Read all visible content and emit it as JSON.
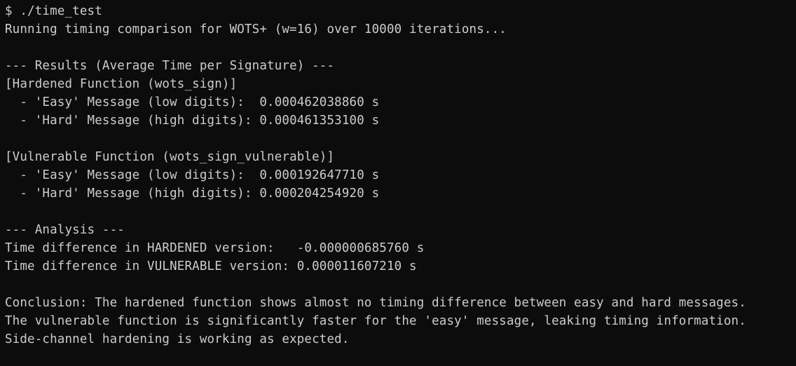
{
  "terminal": {
    "lines": [
      "$ ./time_test",
      "Running timing comparison for WOTS+ (w=16) over 10000 iterations...",
      "",
      "--- Results (Average Time per Signature) ---",
      "[Hardened Function (wots_sign)]",
      "  - 'Easy' Message (low digits):  0.000462038860 s",
      "  - 'Hard' Message (high digits): 0.000461353100 s",
      "",
      "[Vulnerable Function (wots_sign_vulnerable)]",
      "  - 'Easy' Message (low digits):  0.000192647710 s",
      "  - 'Hard' Message (high digits): 0.000204254920 s",
      "",
      "--- Analysis ---",
      "Time difference in HARDENED version:   -0.000000685760 s",
      "Time difference in VULNERABLE version: 0.000011607210 s",
      "",
      "Conclusion: The hardened function shows almost no timing difference between easy and hard messages.",
      "The vulnerable function is significantly faster for the 'easy' message, leaking timing information.",
      "Side-channel hardening is working as expected."
    ]
  },
  "colors": {
    "background": "#0c0c0c",
    "foreground": "#cccccc"
  }
}
